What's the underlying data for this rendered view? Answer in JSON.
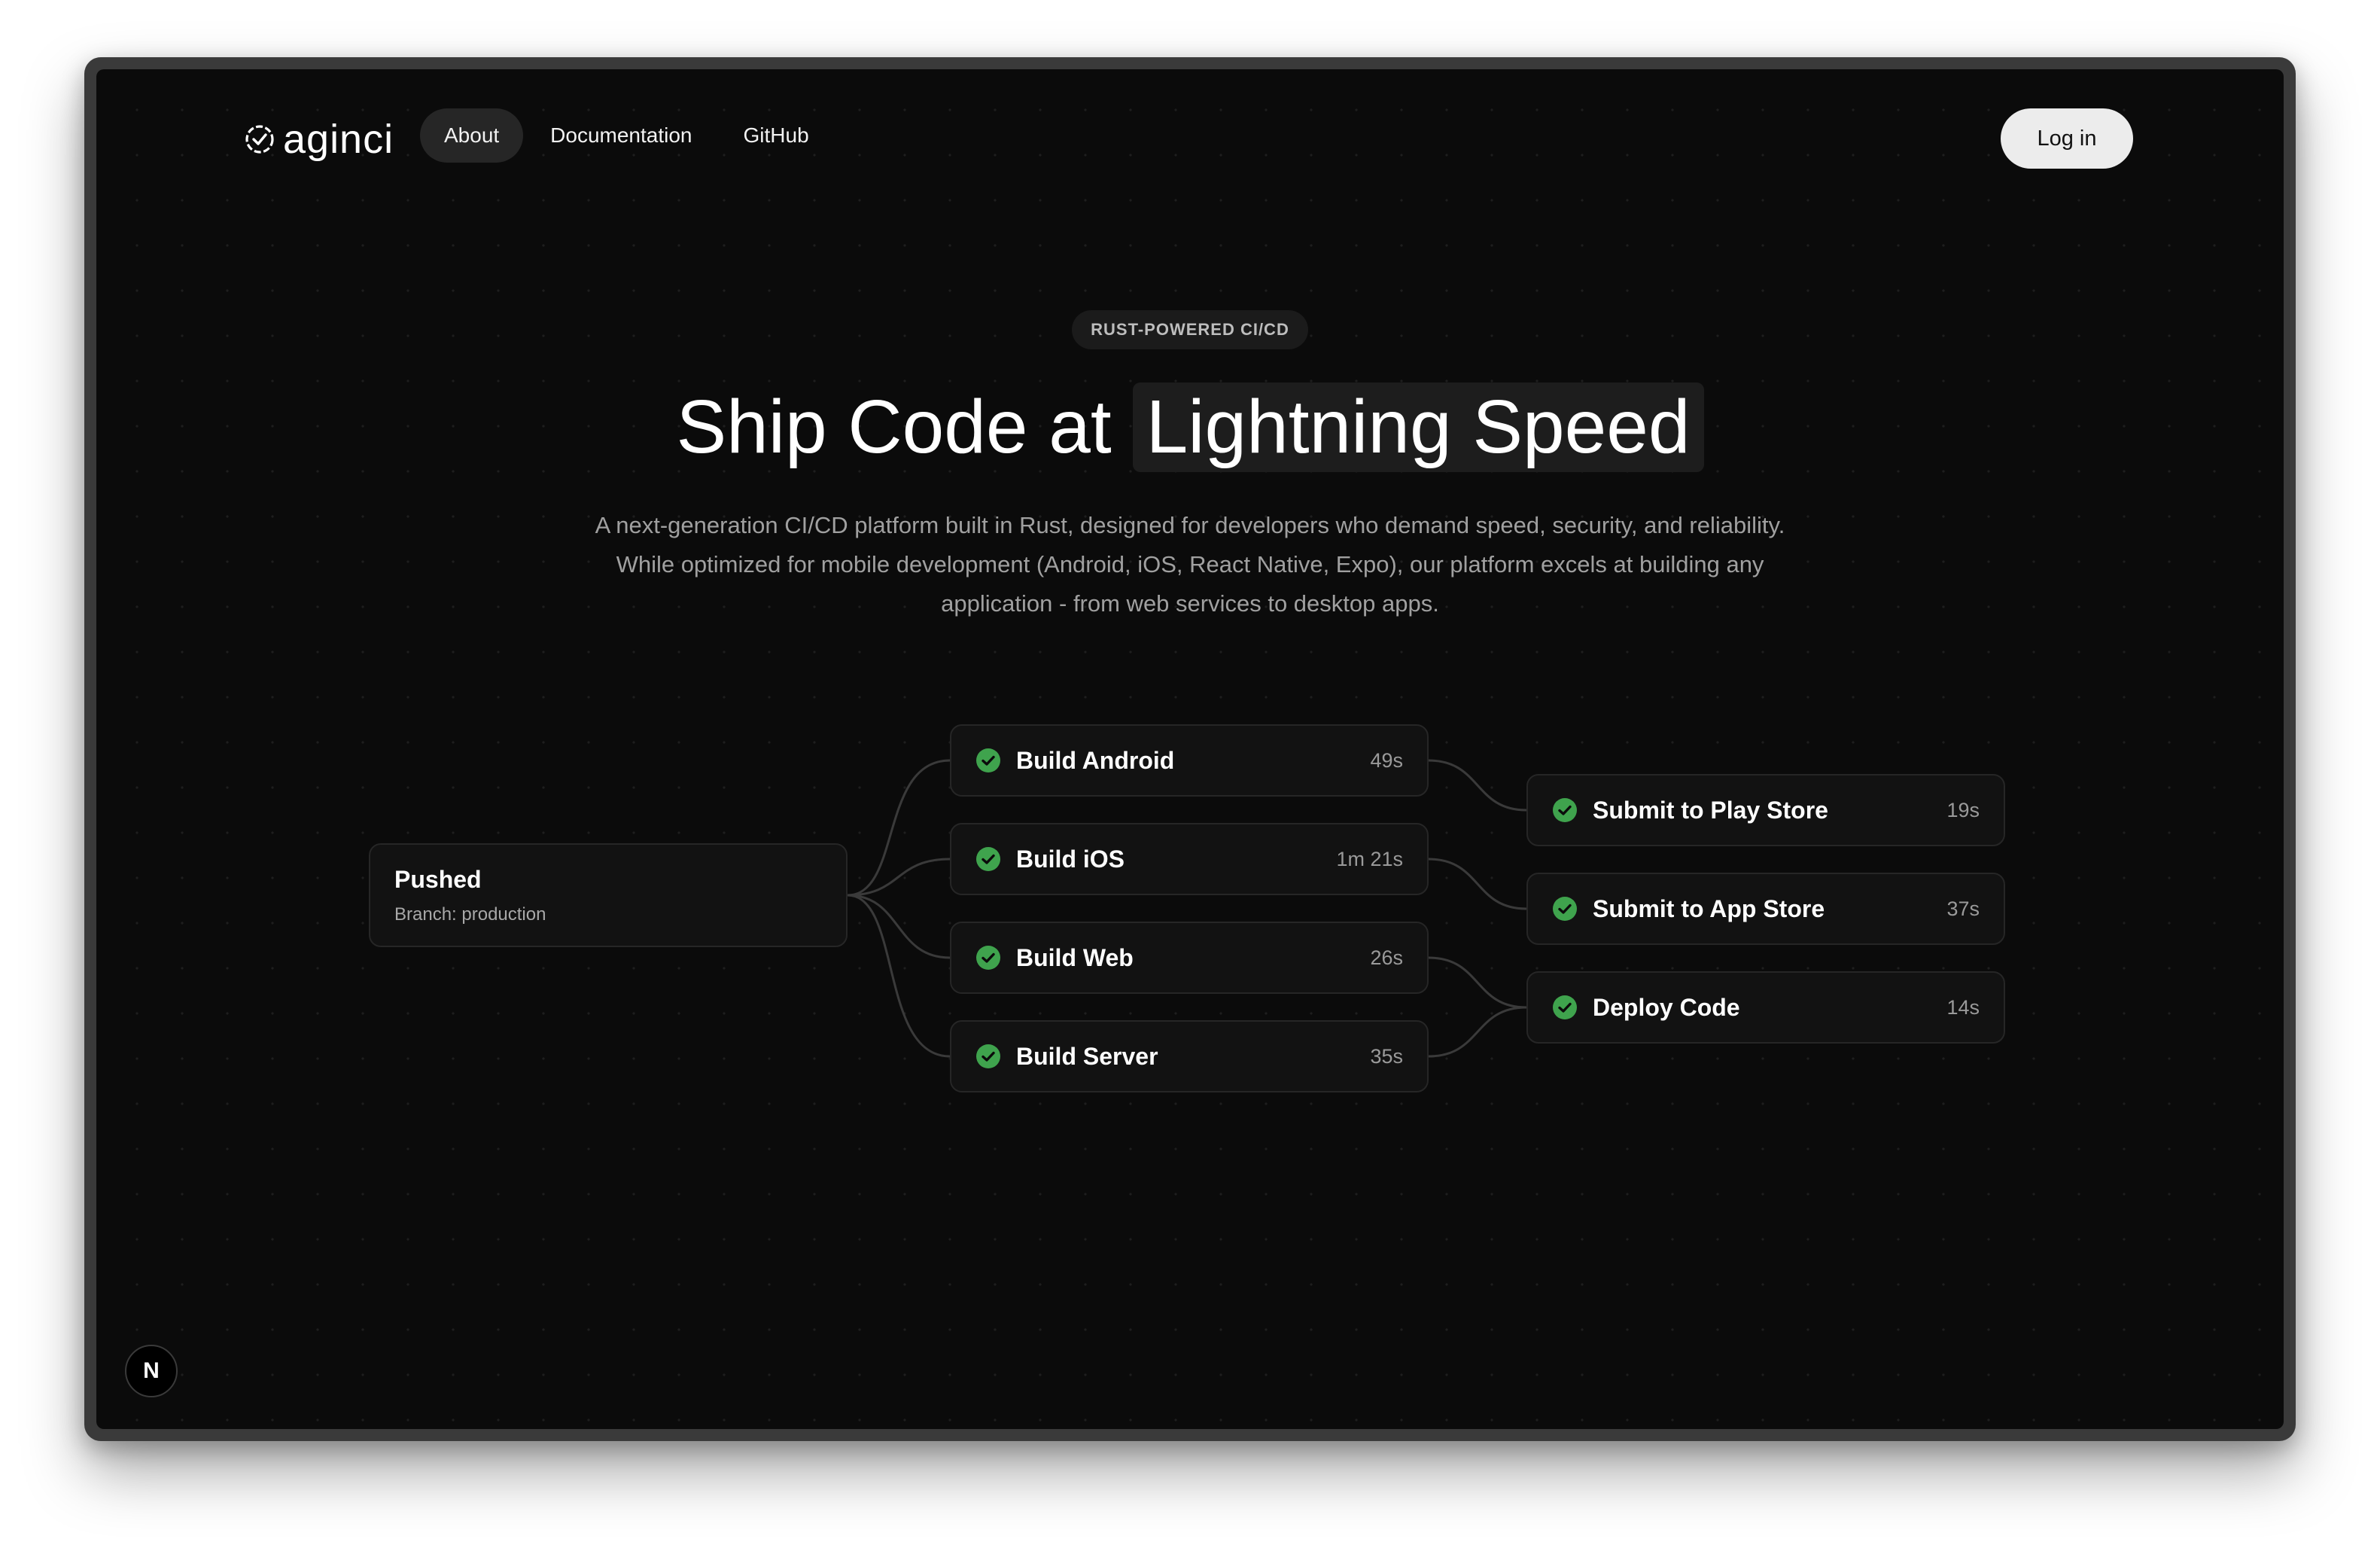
{
  "brand": {
    "name": "aginci",
    "icon": "check-circle-icon"
  },
  "nav": {
    "items": [
      {
        "label": "About",
        "active": true
      },
      {
        "label": "Documentation",
        "active": false
      },
      {
        "label": "GitHub",
        "active": false
      }
    ],
    "login_label": "Log in"
  },
  "hero": {
    "badge": "RUST-POWERED CI/CD",
    "title_plain": "Ship Code at",
    "title_highlight": "Lightning Speed",
    "description": "A next-generation CI/CD platform built in Rust, designed for developers who demand speed, security, and reliability. While optimized for mobile development (Android, iOS, React Native, Expo), our platform excels at building any application - from web services to desktop apps."
  },
  "pipeline": {
    "source": {
      "title": "Pushed",
      "subtitle": "Branch: production"
    },
    "builds": [
      {
        "label": "Build Android",
        "time": "49s",
        "status": "success"
      },
      {
        "label": "Build iOS",
        "time": "1m 21s",
        "status": "success"
      },
      {
        "label": "Build Web",
        "time": "26s",
        "status": "success"
      },
      {
        "label": "Build Server",
        "time": "35s",
        "status": "success"
      }
    ],
    "deploys": [
      {
        "label": "Submit to Play Store",
        "time": "19s",
        "status": "success"
      },
      {
        "label": "Submit to App Store",
        "time": "37s",
        "status": "success"
      },
      {
        "label": "Deploy Code",
        "time": "14s",
        "status": "success"
      }
    ]
  },
  "colors": {
    "background": "#0b0b0b",
    "success": "#3fa34d",
    "card": "#121212"
  },
  "floating_button": {
    "label": "N"
  }
}
